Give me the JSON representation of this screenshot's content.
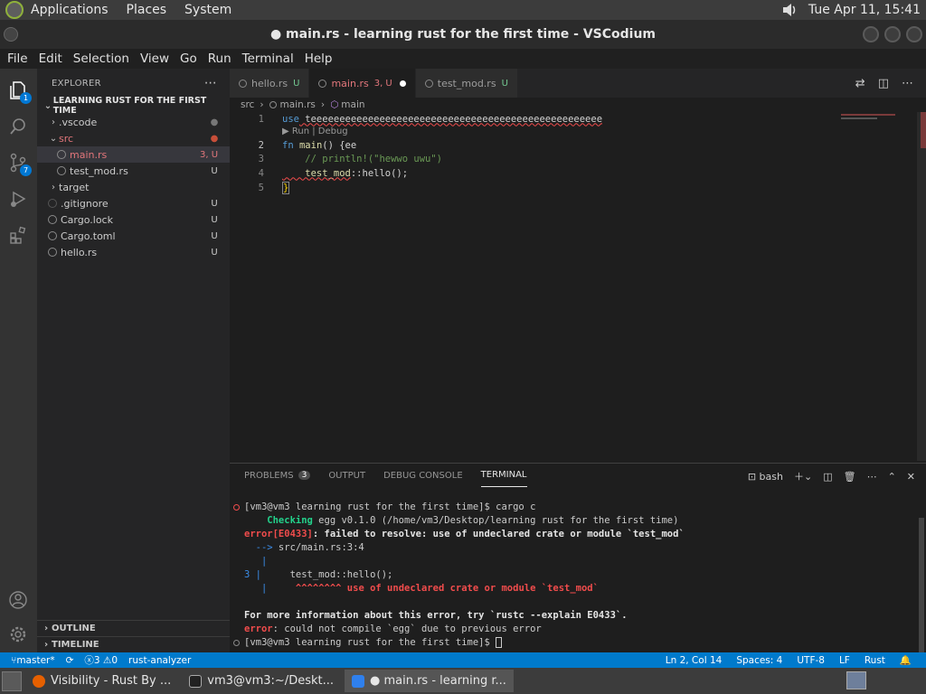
{
  "system_bar": {
    "menus": [
      "Applications",
      "Places",
      "System"
    ],
    "clock": "Tue Apr 11, 15:41"
  },
  "window": {
    "title": "● main.rs - learning rust for the first time - VSCodium"
  },
  "menubar": [
    "File",
    "Edit",
    "Selection",
    "View",
    "Go",
    "Run",
    "Terminal",
    "Help"
  ],
  "activity_bar": {
    "explorer_badge": "1",
    "scm_badge": "7"
  },
  "explorer": {
    "header": "EXPLORER",
    "folder": "LEARNING RUST FOR THE FIRST TIME",
    "items": [
      {
        "name": ".vscode",
        "badge": "●",
        "type": "folder",
        "expanded": false
      },
      {
        "name": "src",
        "badge": "●",
        "type": "folder",
        "expanded": true
      },
      {
        "name": "main.rs",
        "badge": "3, U",
        "type": "file"
      },
      {
        "name": "test_mod.rs",
        "badge": "U",
        "type": "file"
      },
      {
        "name": "target",
        "badge": "",
        "type": "folder",
        "expanded": false
      },
      {
        "name": ".gitignore",
        "badge": "U",
        "type": "file"
      },
      {
        "name": "Cargo.lock",
        "badge": "U",
        "type": "file"
      },
      {
        "name": "Cargo.toml",
        "badge": "U",
        "type": "file"
      },
      {
        "name": "hello.rs",
        "badge": "U",
        "type": "file"
      }
    ],
    "outline": "OUTLINE",
    "timeline": "TIMELINE"
  },
  "tabs": [
    {
      "label": "hello.rs",
      "status": "U"
    },
    {
      "label": "main.rs",
      "status": "3, U"
    },
    {
      "label": "test_mod.rs",
      "status": "U"
    }
  ],
  "breadcrumb": {
    "folder": "src",
    "file": "main.rs",
    "symbol": "main"
  },
  "editor": {
    "line_numbers": [
      "1",
      "2",
      "3",
      "4",
      "5"
    ],
    "line1_kw": "use",
    "line1_rest": " teeeeeeeeeeeeeeeeeeeeeeeeeeeeeeeeeeeeeeeeeeeeeeeeeee",
    "codelens": "▶ Run | Debug",
    "line2_kw": "fn",
    "line2_fn": " main",
    "line2_rest": "() {ee",
    "line3": "    // println!(\"hewwo uwu\")",
    "line4_fn": "    test_mod",
    "line4_rest": "::hello();",
    "line5": "}"
  },
  "panel": {
    "tabs": [
      "PROBLEMS",
      "OUTPUT",
      "DEBUG CONSOLE",
      "TERMINAL"
    ],
    "problems_count": "3",
    "shell": "bash",
    "terminal": {
      "l1": "[vm3@vm3 learning rust for the first time]$ cargo c",
      "l2_tag": "    Checking",
      "l2_rest": " egg v0.1.0 (/home/vm3/Desktop/learning rust for the first time)",
      "l3_tag": "error[E0433]",
      "l3_rest": ": failed to resolve: use of undeclared crate or module `test_mod`",
      "l4_arrow": "  -->",
      "l4_rest": " src/main.rs:3:4",
      "l5": "   |",
      "l6_num": "3 |",
      "l6_rest": "     test_mod::hello();",
      "l7_bar": "   |",
      "l7_rest": "     ^^^^^^^^ use of undeclared crate or module `test_mod`",
      "l8": "For more information about this error, try `rustc --explain E0433`.",
      "l9_tag": "error",
      "l9_rest": ": could not compile `egg` due to previous error",
      "l10": "[vm3@vm3 learning rust for the first time]$ "
    }
  },
  "statusbar": {
    "branch": "master*",
    "errors": "3",
    "warnings": "0",
    "analyzer": "rust-analyzer",
    "position": "Ln 2, Col 14",
    "spaces": "Spaces: 4",
    "encoding": "UTF-8",
    "eol": "LF",
    "language": "Rust"
  },
  "taskbar": [
    {
      "label": "Visibility - Rust By ..."
    },
    {
      "label": "vm3@vm3:~/Deskt..."
    },
    {
      "label": "● main.rs - learning r..."
    }
  ],
  "colors": {
    "accent": "#007acc",
    "error": "#f14c4c",
    "git_untracked": "#73c991",
    "git_modified": "#e2c08d"
  }
}
